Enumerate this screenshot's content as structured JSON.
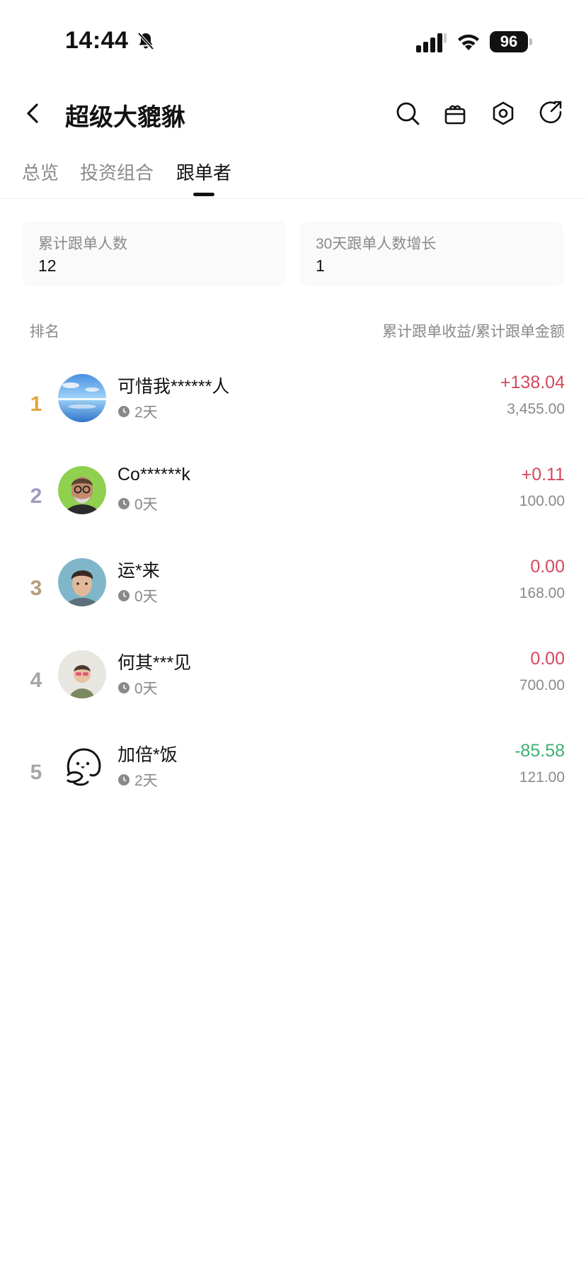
{
  "status_bar": {
    "time": "14:44",
    "battery": "96"
  },
  "header": {
    "title": "超级大貔貅"
  },
  "tabs": [
    {
      "label": "总览"
    },
    {
      "label": "投资组合"
    },
    {
      "label": "跟单者"
    }
  ],
  "active_tab": "跟单者",
  "stats": [
    {
      "label": "累计跟单人数",
      "value": "12"
    },
    {
      "label": "30天跟单人数增长",
      "value": "1"
    }
  ],
  "list_header": {
    "left": "排名",
    "right": "累计跟单收益/累计跟单金额"
  },
  "followers": [
    {
      "rank": "1",
      "name": "可惜我******人",
      "days": "2天",
      "profit": "+138.04",
      "amount": "3,455.00"
    },
    {
      "rank": "2",
      "name": "Co******k",
      "days": "0天",
      "profit": "+0.11",
      "amount": "100.00"
    },
    {
      "rank": "3",
      "name": "运*来",
      "days": "0天",
      "profit": "0.00",
      "amount": "168.00"
    },
    {
      "rank": "4",
      "name": "何其***见",
      "days": "0天",
      "profit": "0.00",
      "amount": "700.00"
    },
    {
      "rank": "5",
      "name": "加倍*饭",
      "days": "2天",
      "profit": "-85.58",
      "amount": "121.00"
    }
  ],
  "colors": {
    "rank_1": "#E3A53A",
    "rank_2": "#9E9BC0",
    "rank_3": "#B59C78",
    "rank_other": "#A6A6A6",
    "gain": "#D5485E",
    "loss": "#3FAF72"
  },
  "icons": [
    "bell-slash-icon",
    "signal-icon",
    "wifi-icon",
    "battery-icon",
    "back-arrow-icon",
    "search-icon",
    "gift-icon",
    "settings-icon",
    "share-icon",
    "clock-icon"
  ]
}
